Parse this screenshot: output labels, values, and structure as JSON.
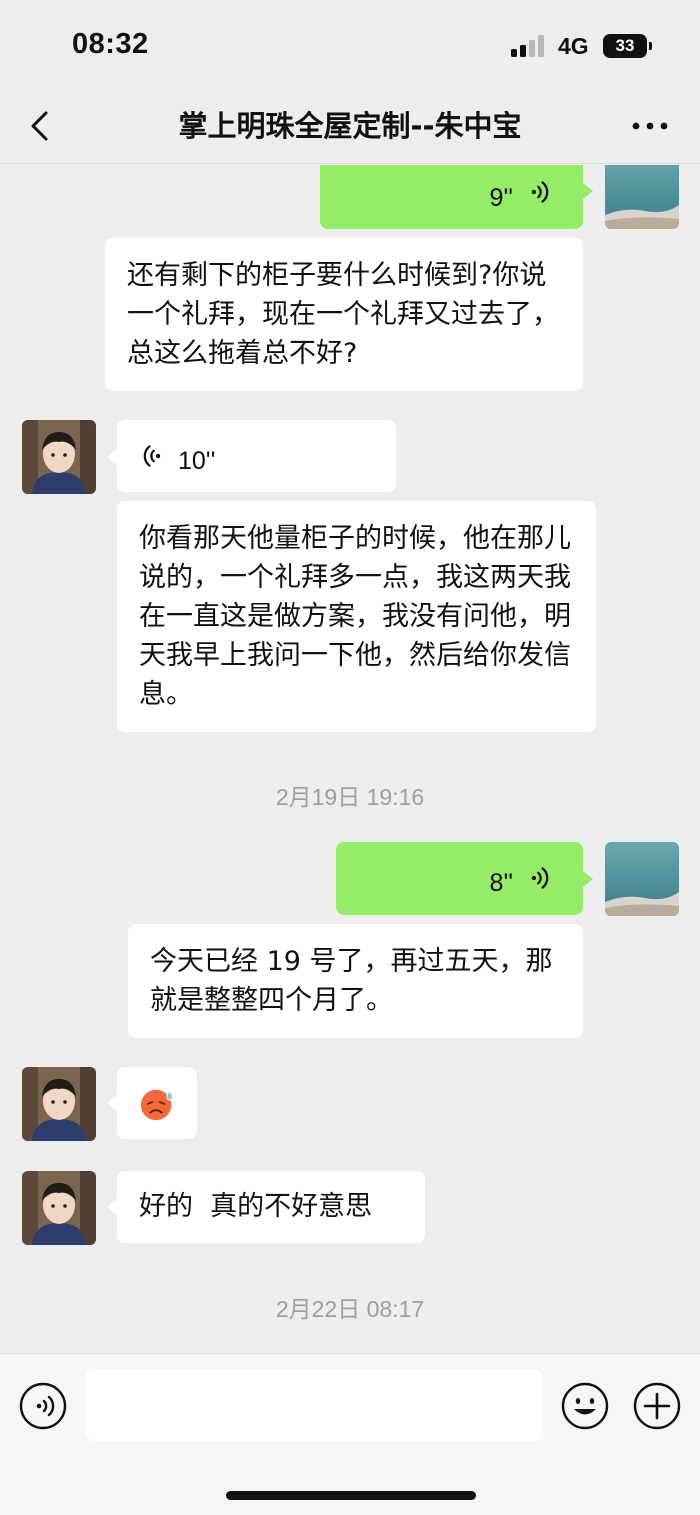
{
  "status_bar": {
    "time": "08:32",
    "network": "4G",
    "battery": "33"
  },
  "header": {
    "title": "掌上明珠全屋定制--朱中宝"
  },
  "messages": [
    {
      "type": "voice",
      "side": "right",
      "duration": "9''"
    },
    {
      "type": "text",
      "side": "right",
      "text": "还有剩下的柜子要什么时候到?你说一个礼拜，现在一个礼拜又过去了，总这么拖着总不好?"
    },
    {
      "type": "voice",
      "side": "left",
      "duration": "10''"
    },
    {
      "type": "text",
      "side": "left",
      "text": "你看那天他量柜子的时候，他在那儿说的，一个礼拜多一点，我这两天我在一直这是做方案，我没有问他，明天我早上我问一下他，然后给你发信息。"
    },
    {
      "type": "timestamp",
      "text": "2月19日 19:16"
    },
    {
      "type": "voice",
      "side": "right",
      "duration": "8''"
    },
    {
      "type": "text",
      "side": "right",
      "text": "今天已经 19 号了，再过五天，那就是整整四个月了。"
    },
    {
      "type": "emoji",
      "side": "left",
      "icon": "sweat-face-emoji"
    },
    {
      "type": "text",
      "side": "left",
      "text": "好的  真的不好意思"
    },
    {
      "type": "timestamp",
      "text": "2月22日 08:17"
    }
  ],
  "input": {
    "value": "",
    "placeholder": ""
  },
  "colors": {
    "background": "#ededed",
    "self_bubble": "#95ec69",
    "other_bubble": "#ffffff",
    "timestamp": "#9e9e9e"
  }
}
